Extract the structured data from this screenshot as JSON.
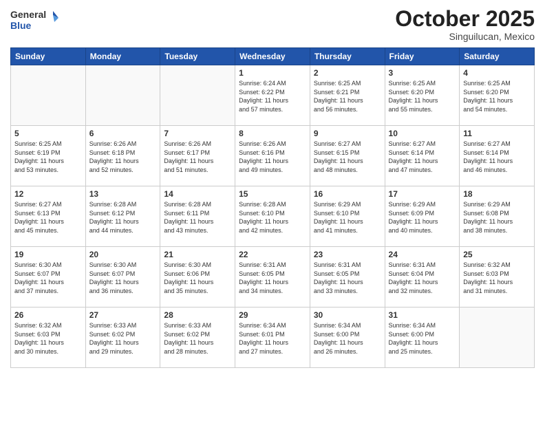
{
  "header": {
    "logo_general": "General",
    "logo_blue": "Blue",
    "month": "October 2025",
    "location": "Singuilucan, Mexico"
  },
  "weekdays": [
    "Sunday",
    "Monday",
    "Tuesday",
    "Wednesday",
    "Thursday",
    "Friday",
    "Saturday"
  ],
  "weeks": [
    [
      {
        "day": "",
        "info": ""
      },
      {
        "day": "",
        "info": ""
      },
      {
        "day": "",
        "info": ""
      },
      {
        "day": "1",
        "info": "Sunrise: 6:24 AM\nSunset: 6:22 PM\nDaylight: 11 hours\nand 57 minutes."
      },
      {
        "day": "2",
        "info": "Sunrise: 6:25 AM\nSunset: 6:21 PM\nDaylight: 11 hours\nand 56 minutes."
      },
      {
        "day": "3",
        "info": "Sunrise: 6:25 AM\nSunset: 6:20 PM\nDaylight: 11 hours\nand 55 minutes."
      },
      {
        "day": "4",
        "info": "Sunrise: 6:25 AM\nSunset: 6:20 PM\nDaylight: 11 hours\nand 54 minutes."
      }
    ],
    [
      {
        "day": "5",
        "info": "Sunrise: 6:25 AM\nSunset: 6:19 PM\nDaylight: 11 hours\nand 53 minutes."
      },
      {
        "day": "6",
        "info": "Sunrise: 6:26 AM\nSunset: 6:18 PM\nDaylight: 11 hours\nand 52 minutes."
      },
      {
        "day": "7",
        "info": "Sunrise: 6:26 AM\nSunset: 6:17 PM\nDaylight: 11 hours\nand 51 minutes."
      },
      {
        "day": "8",
        "info": "Sunrise: 6:26 AM\nSunset: 6:16 PM\nDaylight: 11 hours\nand 49 minutes."
      },
      {
        "day": "9",
        "info": "Sunrise: 6:27 AM\nSunset: 6:15 PM\nDaylight: 11 hours\nand 48 minutes."
      },
      {
        "day": "10",
        "info": "Sunrise: 6:27 AM\nSunset: 6:14 PM\nDaylight: 11 hours\nand 47 minutes."
      },
      {
        "day": "11",
        "info": "Sunrise: 6:27 AM\nSunset: 6:14 PM\nDaylight: 11 hours\nand 46 minutes."
      }
    ],
    [
      {
        "day": "12",
        "info": "Sunrise: 6:27 AM\nSunset: 6:13 PM\nDaylight: 11 hours\nand 45 minutes."
      },
      {
        "day": "13",
        "info": "Sunrise: 6:28 AM\nSunset: 6:12 PM\nDaylight: 11 hours\nand 44 minutes."
      },
      {
        "day": "14",
        "info": "Sunrise: 6:28 AM\nSunset: 6:11 PM\nDaylight: 11 hours\nand 43 minutes."
      },
      {
        "day": "15",
        "info": "Sunrise: 6:28 AM\nSunset: 6:10 PM\nDaylight: 11 hours\nand 42 minutes."
      },
      {
        "day": "16",
        "info": "Sunrise: 6:29 AM\nSunset: 6:10 PM\nDaylight: 11 hours\nand 41 minutes."
      },
      {
        "day": "17",
        "info": "Sunrise: 6:29 AM\nSunset: 6:09 PM\nDaylight: 11 hours\nand 40 minutes."
      },
      {
        "day": "18",
        "info": "Sunrise: 6:29 AM\nSunset: 6:08 PM\nDaylight: 11 hours\nand 38 minutes."
      }
    ],
    [
      {
        "day": "19",
        "info": "Sunrise: 6:30 AM\nSunset: 6:07 PM\nDaylight: 11 hours\nand 37 minutes."
      },
      {
        "day": "20",
        "info": "Sunrise: 6:30 AM\nSunset: 6:07 PM\nDaylight: 11 hours\nand 36 minutes."
      },
      {
        "day": "21",
        "info": "Sunrise: 6:30 AM\nSunset: 6:06 PM\nDaylight: 11 hours\nand 35 minutes."
      },
      {
        "day": "22",
        "info": "Sunrise: 6:31 AM\nSunset: 6:05 PM\nDaylight: 11 hours\nand 34 minutes."
      },
      {
        "day": "23",
        "info": "Sunrise: 6:31 AM\nSunset: 6:05 PM\nDaylight: 11 hours\nand 33 minutes."
      },
      {
        "day": "24",
        "info": "Sunrise: 6:31 AM\nSunset: 6:04 PM\nDaylight: 11 hours\nand 32 minutes."
      },
      {
        "day": "25",
        "info": "Sunrise: 6:32 AM\nSunset: 6:03 PM\nDaylight: 11 hours\nand 31 minutes."
      }
    ],
    [
      {
        "day": "26",
        "info": "Sunrise: 6:32 AM\nSunset: 6:03 PM\nDaylight: 11 hours\nand 30 minutes."
      },
      {
        "day": "27",
        "info": "Sunrise: 6:33 AM\nSunset: 6:02 PM\nDaylight: 11 hours\nand 29 minutes."
      },
      {
        "day": "28",
        "info": "Sunrise: 6:33 AM\nSunset: 6:02 PM\nDaylight: 11 hours\nand 28 minutes."
      },
      {
        "day": "29",
        "info": "Sunrise: 6:34 AM\nSunset: 6:01 PM\nDaylight: 11 hours\nand 27 minutes."
      },
      {
        "day": "30",
        "info": "Sunrise: 6:34 AM\nSunset: 6:00 PM\nDaylight: 11 hours\nand 26 minutes."
      },
      {
        "day": "31",
        "info": "Sunrise: 6:34 AM\nSunset: 6:00 PM\nDaylight: 11 hours\nand 25 minutes."
      },
      {
        "day": "",
        "info": ""
      }
    ]
  ]
}
